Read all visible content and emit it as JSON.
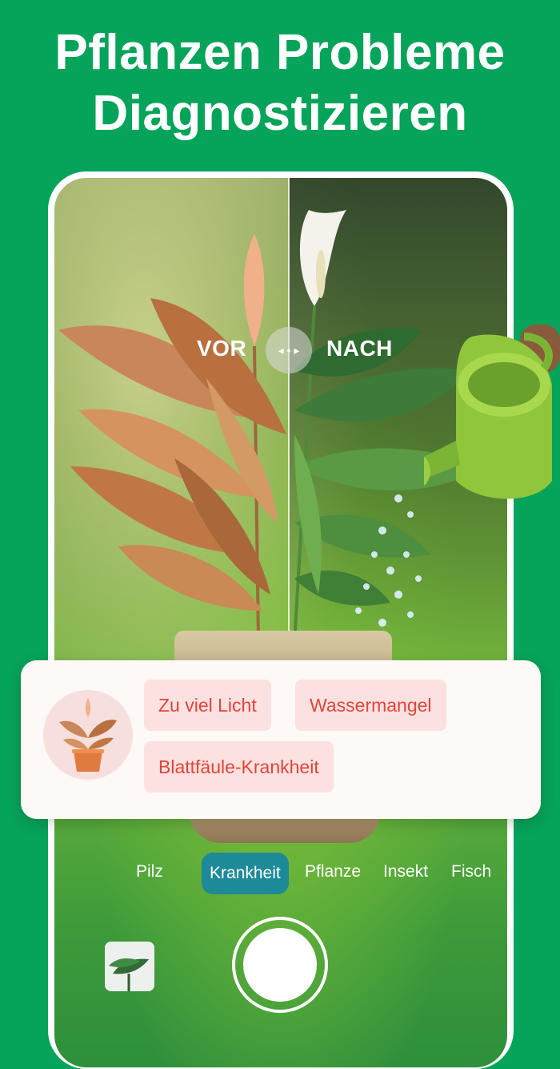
{
  "headline": {
    "line1": "Pflanzen Probleme",
    "line2": "Diagnostizieren"
  },
  "compare": {
    "before_label": "VOR",
    "after_label": "NACH",
    "handle_icon": "split-arrows-icon"
  },
  "diagnosis_card": {
    "chips": [
      "Zu viel Licht",
      "Wassermangel",
      "Blattfäule-Krankheit"
    ],
    "chip_text_color": "#e0443c",
    "chip_bg_color": "#fbe1df"
  },
  "camera": {
    "tabs": [
      {
        "label": "Pilz",
        "active": false
      },
      {
        "label": "Krankheit",
        "active": true
      },
      {
        "label": "Pflanze",
        "active": false
      },
      {
        "label": "Insekt",
        "active": false
      },
      {
        "label": "Fisch",
        "active": false
      }
    ],
    "active_tab_color": "#1d8a97"
  },
  "colors": {
    "background": "#06a35a",
    "card": "#fcf9f6"
  }
}
